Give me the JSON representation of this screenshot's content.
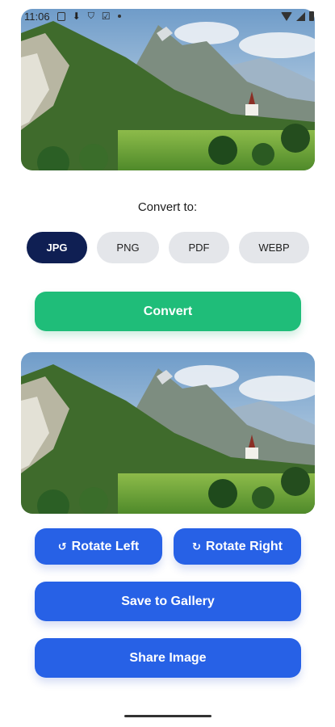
{
  "status_bar": {
    "time": "11:06",
    "icons": [
      "screen-icon",
      "download-icon",
      "shield-icon",
      "checkbox-icon",
      "dot-icon",
      "wifi-icon",
      "signal-icon",
      "battery-icon"
    ]
  },
  "convert_section": {
    "label": "Convert to:",
    "formats": [
      {
        "label": "JPG",
        "selected": true
      },
      {
        "label": "PNG",
        "selected": false
      },
      {
        "label": "PDF",
        "selected": false
      },
      {
        "label": "WEBP",
        "selected": false
      }
    ],
    "convert_button": "Convert"
  },
  "actions": {
    "rotate_left": "Rotate Left",
    "rotate_right": "Rotate Right",
    "rotate_left_icon": "↺",
    "rotate_right_icon": "↻",
    "save": "Save to Gallery",
    "share": "Share Image"
  },
  "images": {
    "original": "mountain-landscape-photo",
    "converted": "mountain-landscape-photo"
  },
  "colors": {
    "selected_chip": "#0f1f53",
    "chip_bg": "#e4e6ea",
    "convert_green": "#1fbd79",
    "action_blue": "#2761e6"
  }
}
